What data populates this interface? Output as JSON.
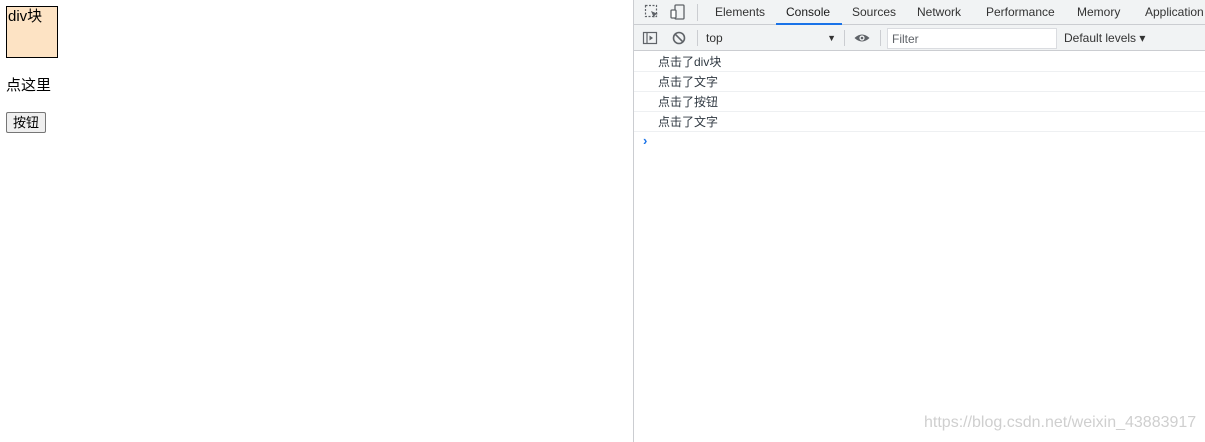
{
  "page": {
    "div_block_text": "div块",
    "paragraph_text": "点这里",
    "button_label": "按钮"
  },
  "devtools": {
    "tabs": [
      "Elements",
      "Console",
      "Sources",
      "Network",
      "Performance",
      "Memory",
      "Application"
    ],
    "active_tab": "Console",
    "context_selector": "top",
    "filter_placeholder": "Filter",
    "levels_label": "Default levels ▾",
    "messages": [
      "点击了div块",
      "点击了文字",
      "点击了按钮",
      "点击了文字"
    ]
  },
  "watermark": "https://blog.csdn.net/weixin_43883917",
  "colors": {
    "div_block_bg": "#fde3c4",
    "active_tab_underline": "#1a73e8",
    "prompt_chevron": "#1a73e8"
  }
}
